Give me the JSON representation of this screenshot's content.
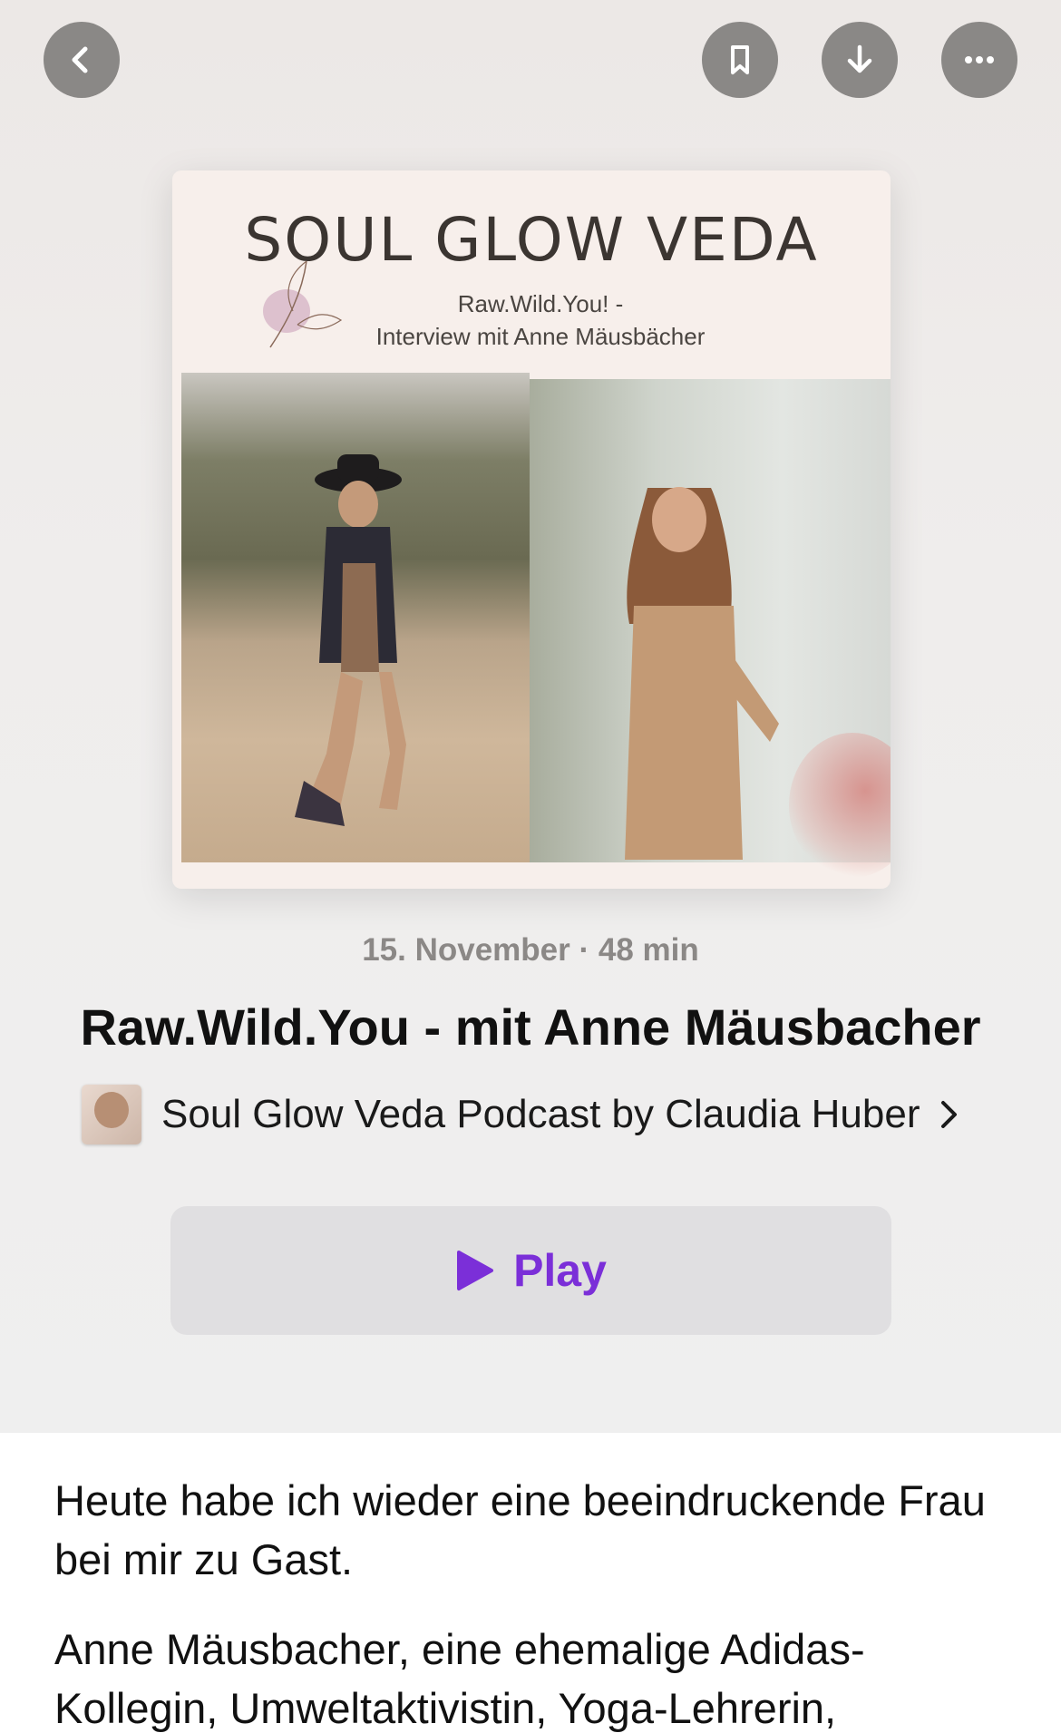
{
  "nav": {
    "back": "chevron-left-icon",
    "bookmark": "bookmark-icon",
    "download": "download-arrow-icon",
    "more": "ellipsis-icon"
  },
  "artwork": {
    "title": "SOUL GLOW VEDA",
    "subtitle_line1": "Raw.Wild.You! -",
    "subtitle_line2": "Interview mit Anne Mäusbächer"
  },
  "episode": {
    "meta": "15. November · 48 min",
    "title": "Raw.Wild.You - mit Anne Mäusbacher",
    "podcast_name": "Soul Glow Veda Podcast by Claudia Huber"
  },
  "play": {
    "label": "Play",
    "accent": "#7b2fd8"
  },
  "description": {
    "paragraph1": "Heute habe ich wieder eine beeindruckende Frau bei mir zu Gast.",
    "paragraph2": "Anne Mäusbacher,  eine ehemalige Adidas-Kollegin, Umweltaktivistin, Yoga-Lehrerin,"
  }
}
